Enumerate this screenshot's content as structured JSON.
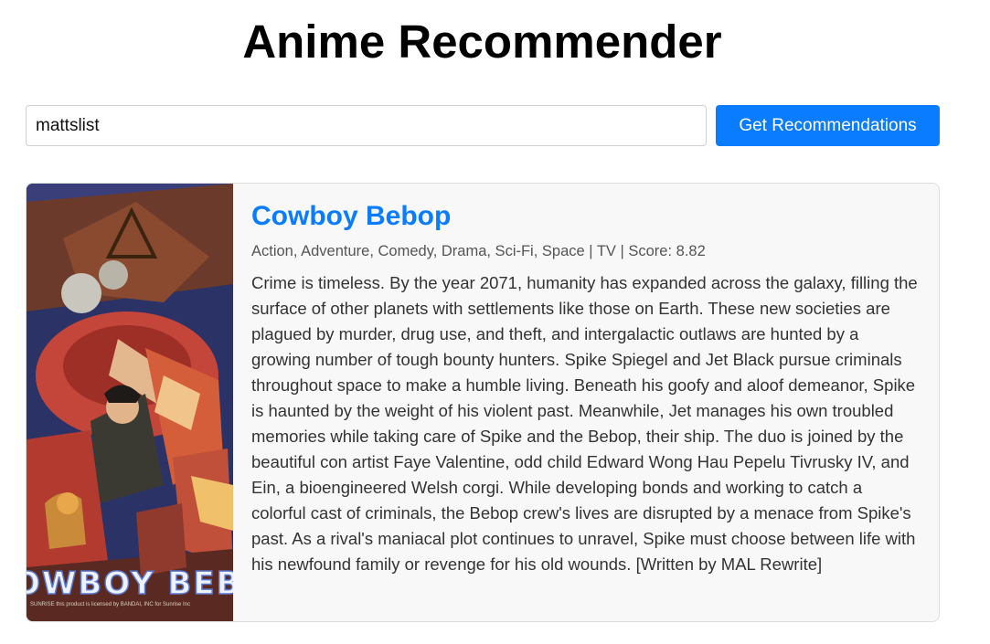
{
  "page": {
    "title": "Anime Recommender"
  },
  "search": {
    "value": "mattslist",
    "button_label": "Get Recommendations"
  },
  "colors": {
    "accent": "#0a7cff",
    "card_bg": "#f8f8f8"
  },
  "results": [
    {
      "title": "Cowboy Bebop",
      "meta": "Action, Adventure, Comedy, Drama, Sci-Fi, Space | TV | Score: 8.82",
      "synopsis": "Crime is timeless. By the year 2071, humanity has expanded across the galaxy, filling the surface of other planets with settlements like those on Earth. These new societies are plagued by murder, drug use, and theft, and intergalactic outlaws are hunted by a growing number of tough bounty hunters. Spike Spiegel and Jet Black pursue criminals throughout space to make a humble living. Beneath his goofy and aloof demeanor, Spike is haunted by the weight of his violent past. Meanwhile, Jet manages his own troubled memories while taking care of Spike and the Bebop, their ship. The duo is joined by the beautiful con artist Faye Valentine, odd child Edward Wong Hau Pepelu Tivrusky IV, and Ein, a bioengineered Welsh corgi. While developing bonds and working to catch a colorful cast of criminals, the Bebop crew's lives are disrupted by a menace from Spike's past. As a rival's maniacal plot continues to unravel, Spike must choose between life with his newfound family or revenge for his old wounds. [Written by MAL Rewrite]",
      "poster": {
        "logo_text": "OWBOY BEBO",
        "fine_print": "SUNRISE this product is licensed by BANDAI, INC for Sunrise Inc"
      }
    }
  ]
}
